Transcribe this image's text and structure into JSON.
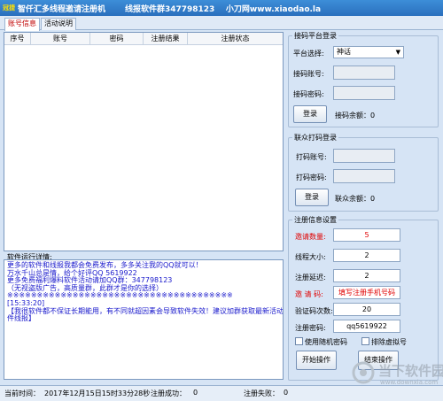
{
  "app": {
    "icon_text": "冠捷",
    "title": "智仟汇多线程邀请注册机",
    "qq_group": "线报软件群347798123",
    "website": "小刀网www.xiaodao.la"
  },
  "tabs": [
    "账号信息",
    "活动说明"
  ],
  "table": {
    "columns": [
      "序号",
      "账号",
      "密码",
      "注册结果",
      "注册状态"
    ]
  },
  "log": {
    "label": "软件运行详情:",
    "lines": [
      "更多的软件和线报我都会免费发布，多多关注我的QQ就可以！",
      "万水千山总是情，给个好评QQ 5619922",
      "更多免费福利爆料软件活动请加QQ群：347798123",
      "（无视盗版广告，高质量群，此群才是你的选择）",
      "※※※※※※※※※※※※※※※※※※※※※※※※※※※※※※※※※※※※※※",
      "[15:33:20]",
      "【我很软件都不保证长期能用，有不同就超因素会导致软件失效！建议加群获取最新活动软",
      "件线报】"
    ]
  },
  "codeplatform": {
    "title": "接码平台登录",
    "platform_label": "平台选择:",
    "platform_value": "神话",
    "account_label": "接码账号:",
    "password_label": "接码密码:",
    "login_button": "登录",
    "balance": "接码余额：0"
  },
  "captcha": {
    "title": "联众打码登录",
    "account_label": "打码账号:",
    "password_label": "打码密码:",
    "login_button": "登录",
    "balance": "联众余额：0"
  },
  "settings": {
    "title": "注册信息设置",
    "invite_count_label": "邀请数量:",
    "invite_count": "5",
    "threads_label": "线程大小:",
    "threads": "2",
    "delay_label": "注册延迟:",
    "delay": "2",
    "invite_code_label": "邀 请 码:",
    "invite_code": "填写注册手机号码",
    "verify_label": "验证码次数:",
    "verify": "20",
    "password_label": "注册密码:",
    "password": "qq5619922",
    "random_pwd_label": "使用随机密码",
    "exclude_label": "排除虚拟号",
    "start_button": "开始操作",
    "stop_button": "结束操作"
  },
  "status": {
    "time_label": "当前时间：",
    "time_value": "2017年12月15日15时33分28秒",
    "success_label": "注册成功：",
    "success_value": "0",
    "fail_label": "注册失败：",
    "fail_value": "0"
  },
  "watermark": {
    "text": "当下软件园",
    "sub": "www.downxia.com"
  },
  "colors": {
    "title_bar": "#2a6fbd",
    "log_text": "#1a1acc",
    "highlight": "#e00000"
  }
}
